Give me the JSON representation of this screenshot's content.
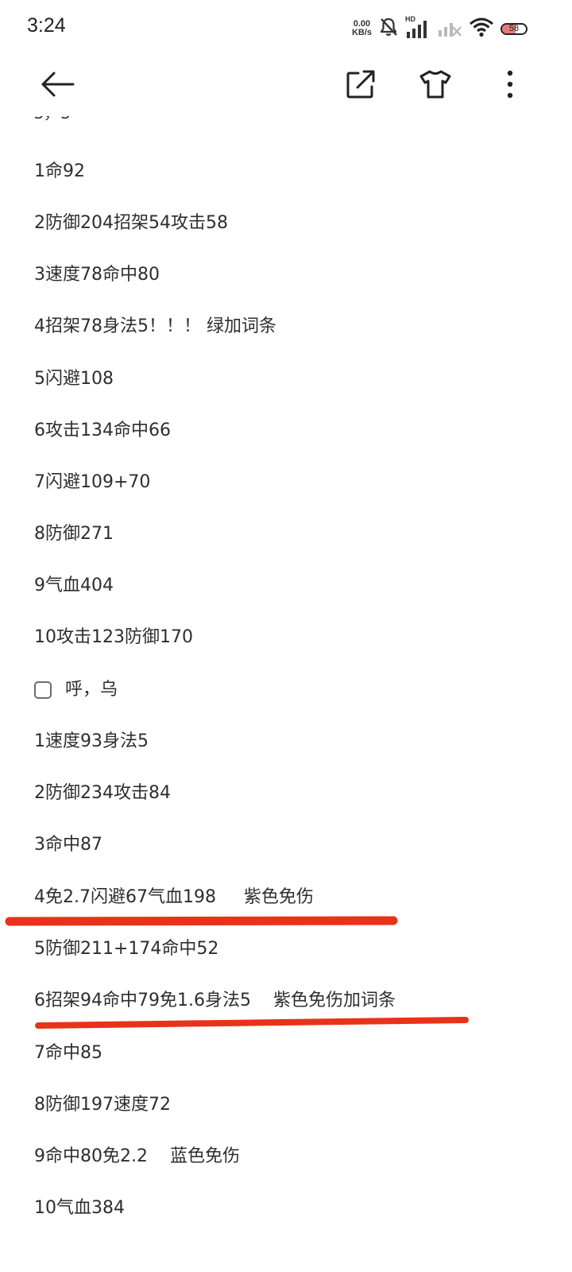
{
  "status_bar": {
    "time": "3:24",
    "net_speed_value": "0.00",
    "net_speed_unit": "KB/s",
    "hd_label": "HD",
    "battery_level": "58",
    "icons": [
      "mute-bell-icon",
      "signal-hd-icon",
      "signal-no-service-icon",
      "wifi-icon",
      "battery-icon"
    ]
  },
  "toolbar": {
    "icons": [
      "back-arrow-icon",
      "share-icon",
      "theme-shirt-icon",
      "more-vertical-icon"
    ]
  },
  "note": {
    "partial_top_text": "s，s",
    "lines": [
      {
        "text": "1命92"
      },
      {
        "text": "2防御204招架54攻击58"
      },
      {
        "text": "3速度78命中80"
      },
      {
        "text": "4招架78身法5！！！ 绿加词条"
      },
      {
        "text": "5闪避108"
      },
      {
        "text": "6攻击134命中66"
      },
      {
        "text": "7闪避109+70"
      },
      {
        "text": "8防御271"
      },
      {
        "text": "9气血404"
      },
      {
        "text": "10攻击123防御170"
      },
      {
        "text": "呼，乌",
        "checkbox": true
      },
      {
        "text": "1速度93身法5"
      },
      {
        "text": "2防御234攻击84"
      },
      {
        "text": "3命中87"
      },
      {
        "text": "4免2.7闪避67气血198     紫色免伤",
        "underlined": true
      },
      {
        "text": "5防御211+174命中52"
      },
      {
        "text": "6招架94命中79免1.6身法5    紫色免伤加词条",
        "underlined": true
      },
      {
        "text": "7命中85"
      },
      {
        "text": "8防御197速度72"
      },
      {
        "text": "9命中80免2.2    蓝色免伤"
      },
      {
        "text": "10气血384"
      }
    ]
  },
  "colors": {
    "underline_red": "#e8321a",
    "text": "#2e2e2e"
  }
}
